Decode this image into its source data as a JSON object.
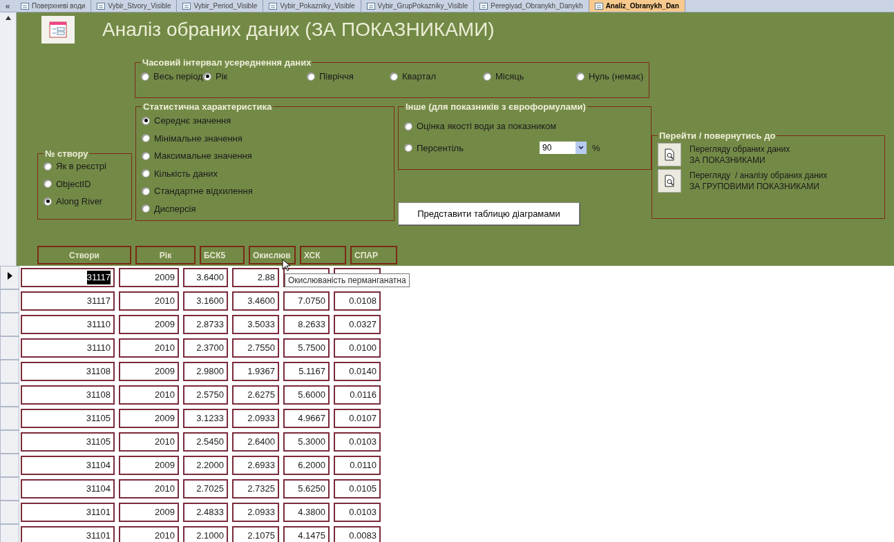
{
  "tabs": [
    {
      "label": "Поверхневі води",
      "selected": false
    },
    {
      "label": "Vybir_Stvory_Visible",
      "selected": false
    },
    {
      "label": "Vybir_Period_Visible",
      "selected": false
    },
    {
      "label": "Vybir_Pokazniky_Visible",
      "selected": false
    },
    {
      "label": "Vybir_GrupPokazniky_Visible",
      "selected": false
    },
    {
      "label": "Peregiyad_Obranykh_Danykh",
      "selected": false
    },
    {
      "label": "Analiz_Obranykh_Dan",
      "selected": true
    }
  ],
  "nav_collapse": "«",
  "title": "Аналіз обраних даних (ЗА ПОКАЗНИКАМИ)",
  "time_interval": {
    "legend": "Часовий інтервал усереднення даних",
    "options": [
      {
        "label": "Весь період",
        "selected": false
      },
      {
        "label": "Рік",
        "selected": true
      },
      {
        "label": "Півріччя",
        "selected": false
      },
      {
        "label": "Квартал",
        "selected": false
      },
      {
        "label": "Місяць",
        "selected": false
      },
      {
        "label": "Нуль (немає)",
        "selected": false
      }
    ]
  },
  "station_number": {
    "legend": "№ створу",
    "options": [
      {
        "label": "Як в реєстрі",
        "selected": false
      },
      {
        "label": "ObjectID",
        "selected": false
      },
      {
        "label": "Along River",
        "selected": true
      }
    ]
  },
  "statistic": {
    "legend": "Статистична характеристика",
    "options": [
      {
        "label": "Середнє значення",
        "selected": true
      },
      {
        "label": "Мінімальне значення",
        "selected": false
      },
      {
        "label": "Максимальне значення",
        "selected": false
      },
      {
        "label": "Кількість даних",
        "selected": false
      },
      {
        "label": "Стандартне відхилення",
        "selected": false
      },
      {
        "label": "Дисперсія",
        "selected": false
      }
    ]
  },
  "other": {
    "legend": "Інше (для показників з євроформулами)",
    "options": [
      {
        "label": "Оцінка якості води за показником",
        "selected": false
      },
      {
        "label": "Персентіль",
        "selected": false
      }
    ],
    "percentile": "90",
    "unit": "%"
  },
  "chart_button": "Представити таблицю діаграмами",
  "navigation": {
    "legend": "Перейти / повернутись до",
    "buttons": [
      "Перегляду обраних даних\nЗА ПОКАЗНИКАМИ",
      "Перегляду  / аналізу обраних даних\nЗА ГРУПОВИМИ ПОКАЗНИКАМИ"
    ]
  },
  "table": {
    "columns": [
      "Створи",
      "Рік",
      "БСК5",
      "Окислюв",
      "ХСК",
      "СПАР"
    ],
    "tooltip": "Окислюваність перманганатна",
    "rows": [
      {
        "selected": true,
        "cells": [
          "31117",
          "2009",
          "3.6400",
          "2.88"
        ]
      },
      {
        "selected": false,
        "cells": [
          "31117",
          "2010",
          "3.1600",
          "3.4600",
          "7.0750",
          "0.0108"
        ]
      },
      {
        "selected": false,
        "cells": [
          "31110",
          "2009",
          "2.8733",
          "3.5033",
          "8.2633",
          "0.0327"
        ]
      },
      {
        "selected": false,
        "cells": [
          "31110",
          "2010",
          "2.3700",
          "2.7550",
          "5.7500",
          "0.0100"
        ]
      },
      {
        "selected": false,
        "cells": [
          "31108",
          "2009",
          "2.9800",
          "1.9367",
          "5.1167",
          "0.0140"
        ]
      },
      {
        "selected": false,
        "cells": [
          "31108",
          "2010",
          "2.5750",
          "2.6275",
          "5.6000",
          "0.0116"
        ]
      },
      {
        "selected": false,
        "cells": [
          "31105",
          "2009",
          "3.1233",
          "2.0933",
          "4.9667",
          "0.0107"
        ]
      },
      {
        "selected": false,
        "cells": [
          "31105",
          "2010",
          "2.5450",
          "2.6400",
          "5.3000",
          "0.0103"
        ]
      },
      {
        "selected": false,
        "cells": [
          "31104",
          "2009",
          "2.2000",
          "2.6933",
          "6.2000",
          "0.0110"
        ]
      },
      {
        "selected": false,
        "cells": [
          "31104",
          "2010",
          "2.7025",
          "2.7325",
          "5.6250",
          "0.0105"
        ]
      },
      {
        "selected": false,
        "cells": [
          "31101",
          "2009",
          "2.4833",
          "2.0933",
          "4.3800",
          "0.0103"
        ]
      },
      {
        "selected": false,
        "cells": [
          "31101",
          "2010",
          "2.1000",
          "2.1075",
          "4.1475",
          "0.0083"
        ]
      }
    ]
  }
}
